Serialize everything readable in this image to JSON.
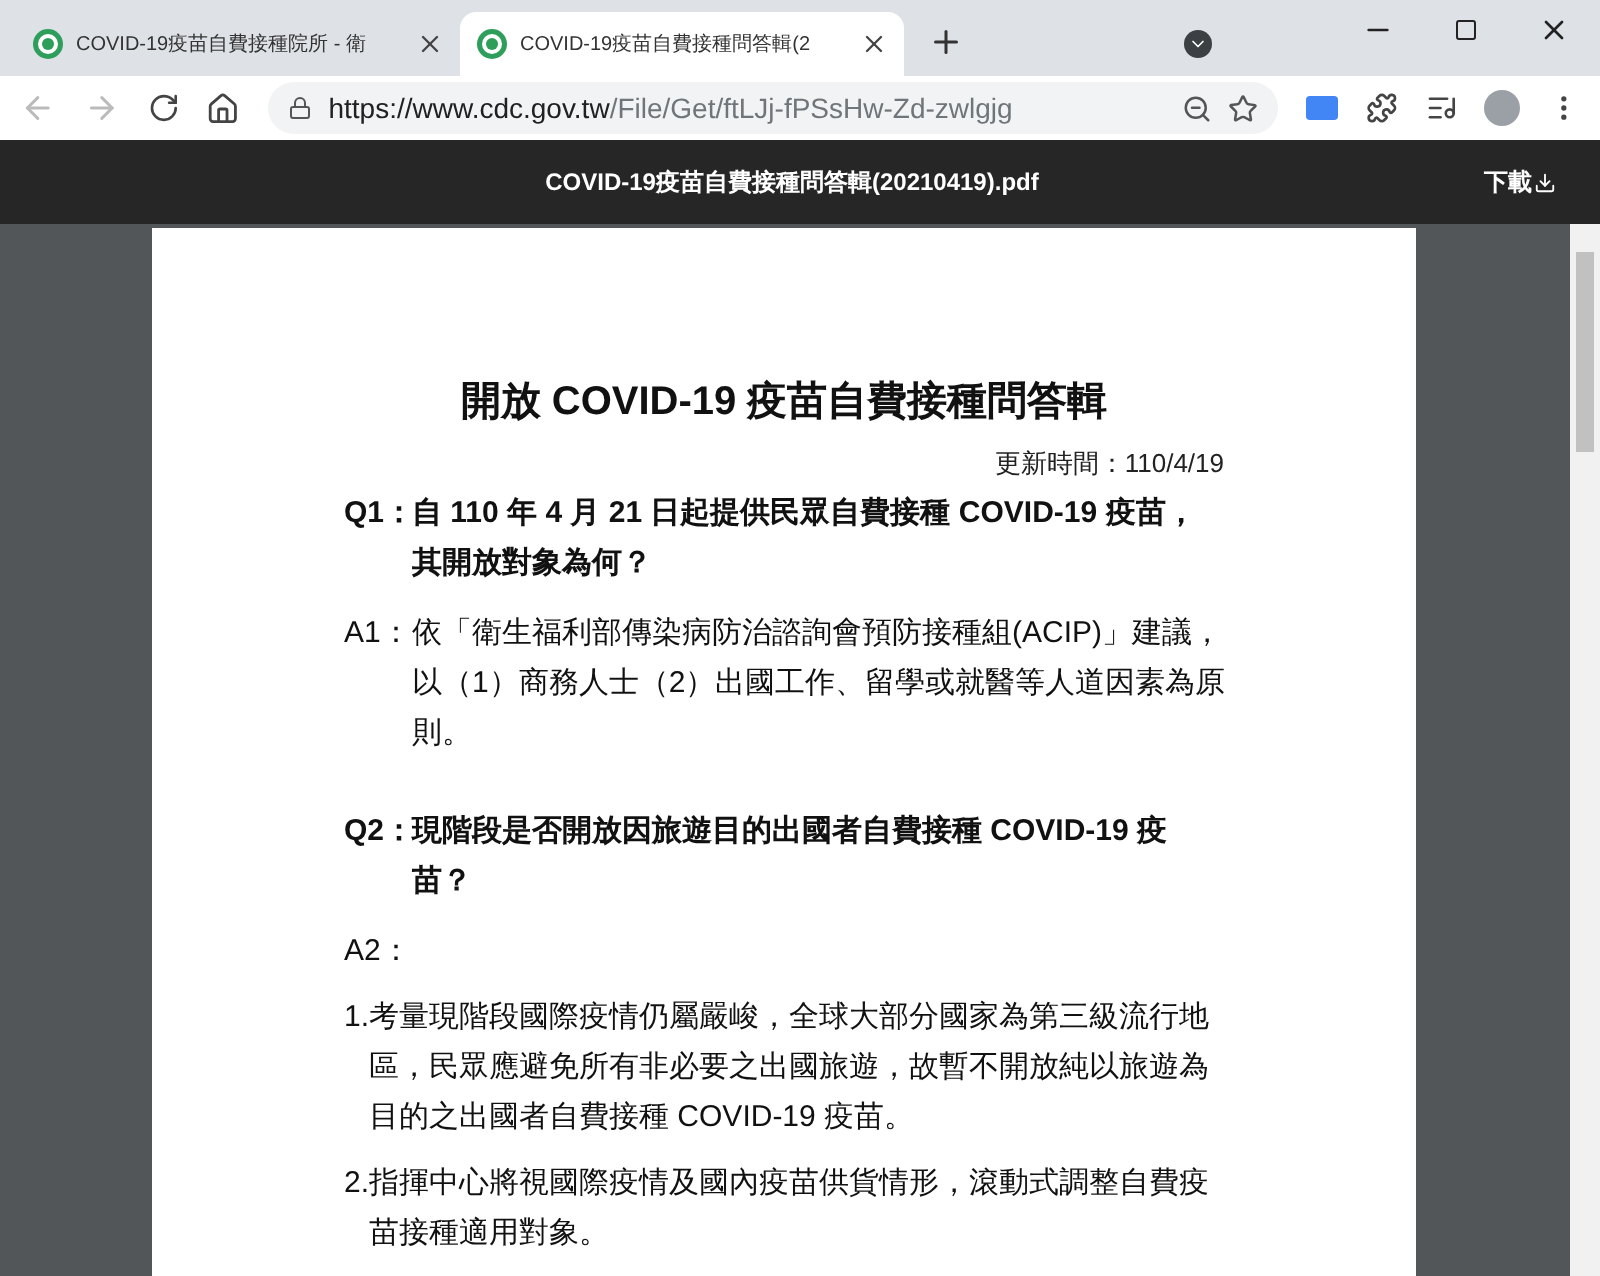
{
  "tabs": [
    {
      "title": "COVID-19疫苗自費接種院所 - 衛",
      "selected": false
    },
    {
      "title": "COVID-19疫苗自費接種問答輯(2",
      "selected": true
    }
  ],
  "address_bar": {
    "url_host": "https://www.cdc.gov.tw",
    "url_path": "/File/Get/ftLJj-fPSsHw-Zd-zwlgjg"
  },
  "pdf_toolbar": {
    "file_name": "COVID-19疫苗自費接種問答輯(20210419).pdf",
    "download": "下載"
  },
  "document": {
    "title": "開放 COVID-19 疫苗自費接種問答輯",
    "updated": "更新時間：110/4/19",
    "blocks": [
      {
        "kind": "question",
        "label": "Q1：",
        "lines": [
          "自 110 年 4 月 21 日起提供民眾自費接種 COVID-19 疫苗，",
          "其開放對象為何？"
        ]
      },
      {
        "kind": "answer",
        "label": "A1：",
        "lines": [
          "依「衛生福利部傳染病防治諮詢會預防接種組(ACIP)」建議，",
          "以（1）商務人士（2）出國工作、留學或就醫等人道因素為原",
          "則。"
        ]
      },
      {
        "kind": "question",
        "label": "Q2：",
        "lines": [
          "現階段是否開放因旅遊目的出國者自費接種 COVID-19 疫",
          "苗？"
        ]
      },
      {
        "kind": "answer",
        "label": "A2："
      },
      {
        "kind": "item",
        "label": "1.",
        "lines": [
          "考量現階段國際疫情仍屬嚴峻，全球大部分國家為第三級流行地",
          "區，民眾應避免所有非必要之出國旅遊，故暫不開放純以旅遊為",
          "目的之出國者自費接種 COVID-19 疫苗。"
        ]
      },
      {
        "kind": "item",
        "label": "2.",
        "lines": [
          "指揮中心將視國際疫情及國內疫苗供貨情形，滾動式調整自費疫",
          "苗接種適用對象。"
        ]
      }
    ]
  }
}
